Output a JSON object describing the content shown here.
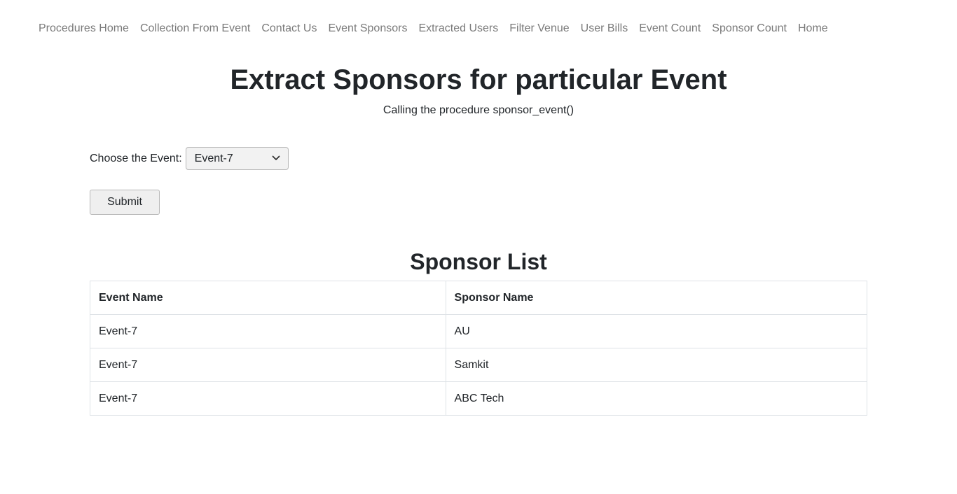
{
  "nav": {
    "items": [
      "Procedures Home",
      "Collection From Event",
      "Contact Us",
      "Event Sponsors",
      "Extracted Users",
      "Filter Venue",
      "User Bills",
      "Event Count",
      "Sponsor Count",
      "Home"
    ]
  },
  "header": {
    "title": "Extract Sponsors for particular Event",
    "subtitle": "Calling the procedure sponsor_event()"
  },
  "form": {
    "label": "Choose the Event:",
    "selected_event": "Event-7",
    "submit_label": "Submit"
  },
  "sponsor_list": {
    "title": "Sponsor List",
    "columns": [
      "Event Name",
      "Sponsor Name"
    ],
    "rows": [
      [
        "Event-7",
        "AU"
      ],
      [
        "Event-7",
        "Samkit"
      ],
      [
        "Event-7",
        "ABC Tech"
      ]
    ]
  },
  "icons": {
    "select_chevron": "chevron-down-icon"
  }
}
